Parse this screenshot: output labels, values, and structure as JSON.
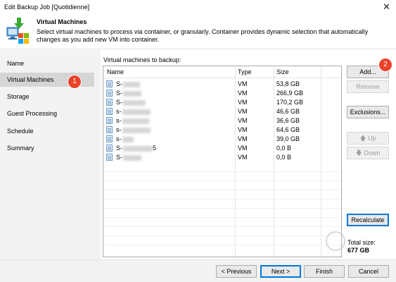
{
  "window": {
    "title": "Edit Backup Job [Quotidienne]",
    "close_glyph": "✕"
  },
  "header": {
    "title": "Virtual Machines",
    "description": "Select virtual machines to process via container, or granularly. Container provides dynamic selection that automatically changes as you add new VM into container."
  },
  "sidebar": {
    "items": [
      {
        "label": "Name"
      },
      {
        "label": "Virtual Machines"
      },
      {
        "label": "Storage"
      },
      {
        "label": "Guest Processing"
      },
      {
        "label": "Schedule"
      },
      {
        "label": "Summary"
      }
    ]
  },
  "badges": {
    "one": "1",
    "two": "2"
  },
  "grid": {
    "label": "Virtual machines to backup:",
    "columns": [
      "Name",
      "Type",
      "Size"
    ],
    "rows": [
      {
        "name": "S-",
        "type": "VM",
        "size": "53,8 GB"
      },
      {
        "name": "S-",
        "type": "VM",
        "size": "266,9 GB"
      },
      {
        "name": "S-",
        "type": "VM",
        "size": "170,2 GB"
      },
      {
        "name": "s-",
        "type": "VM",
        "size": "46,6 GB"
      },
      {
        "name": "s-",
        "type": "VM",
        "size": "36,6 GB"
      },
      {
        "name": "s-",
        "type": "VM",
        "size": "64,6 GB"
      },
      {
        "name": "s-",
        "type": "VM",
        "size": "39,0 GB"
      },
      {
        "name": "S-",
        "name_suffix": "5",
        "type": "VM",
        "size": "0,0 B"
      },
      {
        "name": "S-",
        "type": "VM",
        "size": "0,0 B"
      }
    ]
  },
  "actions": {
    "add": "Add...",
    "remove": "Remove",
    "exclusions": "Exclusions...",
    "up": "Up",
    "down": "Down",
    "recalculate": "Recalculate",
    "up_arrow": "🡅",
    "down_arrow": "🡇"
  },
  "total": {
    "label": "Total size:",
    "value": "677 GB"
  },
  "footer": {
    "previous": "< Previous",
    "next": "Next >",
    "finish": "Finish",
    "cancel": "Cancel"
  },
  "colors": {
    "badge": "#e9432b",
    "active_nav": "#d5d5d5",
    "sidebar_bg": "#f3f3f3",
    "primary_border": "#0078d7"
  }
}
